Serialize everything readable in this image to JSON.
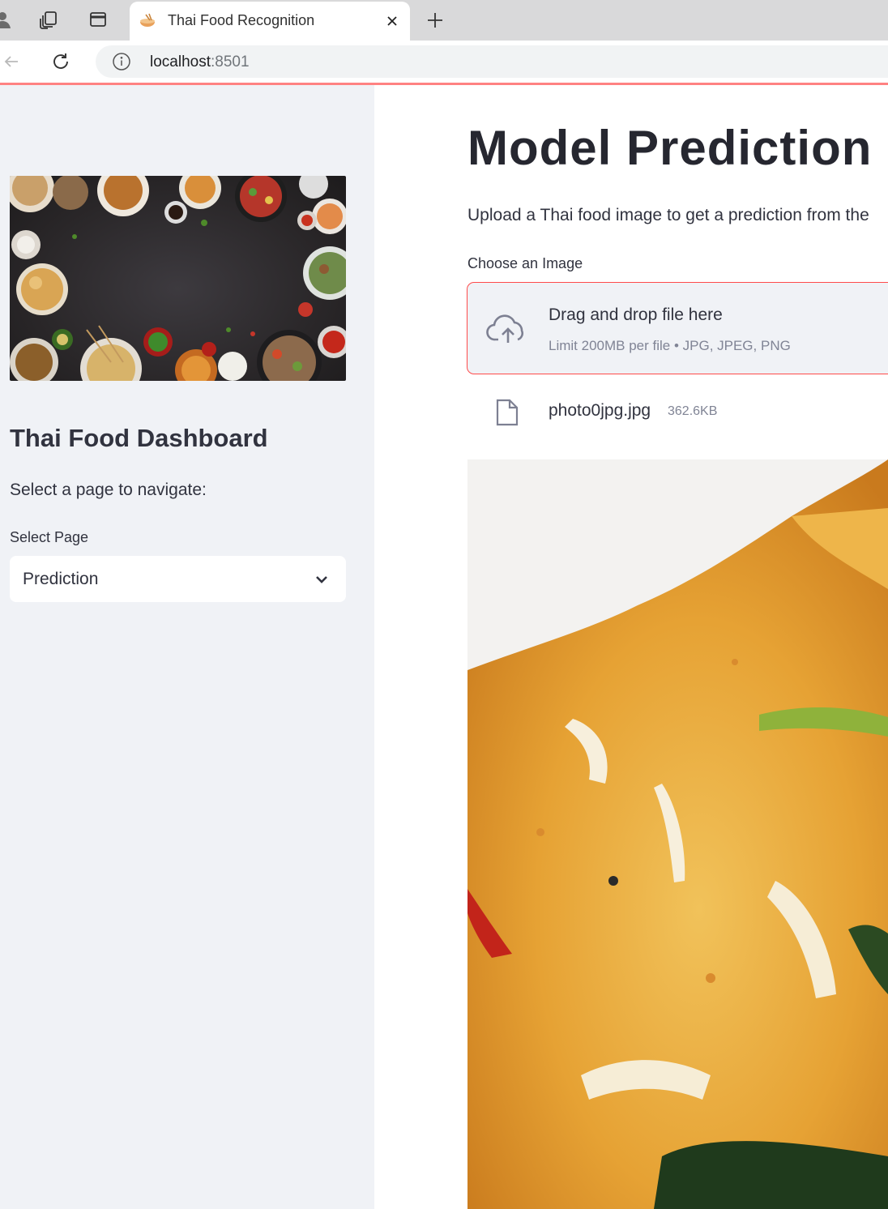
{
  "browser": {
    "tab_title": "Thai Food Recognition",
    "url_host": "localhost",
    "url_port": ":8501"
  },
  "sidebar": {
    "title": "Thai Food Dashboard",
    "subtitle": "Select a page to navigate:",
    "select_label": "Select Page",
    "select_value": "Prediction"
  },
  "main": {
    "title": "Model Prediction",
    "intro": "Upload a Thai food image to get a prediction from the",
    "uploader_label": "Choose an Image",
    "dropzone": {
      "title": "Drag and drop file here",
      "limit": "Limit 200MB per file • JPG, JPEG, PNG"
    },
    "file": {
      "name": "photo0jpg.jpg",
      "size": "362.6KB"
    }
  },
  "colors": {
    "accent": "#ff4b4b",
    "sidebar_bg": "#f0f2f6",
    "text": "#31333f"
  },
  "icons": {
    "profile": "profile-icon",
    "workspaces": "workspaces-icon",
    "tab_actions": "tab-actions-icon",
    "favicon": "food-favicon",
    "close": "close-icon",
    "new_tab": "plus-icon",
    "back": "back-arrow-icon",
    "reload": "reload-icon",
    "info": "info-icon",
    "chevron": "chevron-down-icon",
    "upload": "cloud-upload-icon",
    "file": "file-icon"
  }
}
